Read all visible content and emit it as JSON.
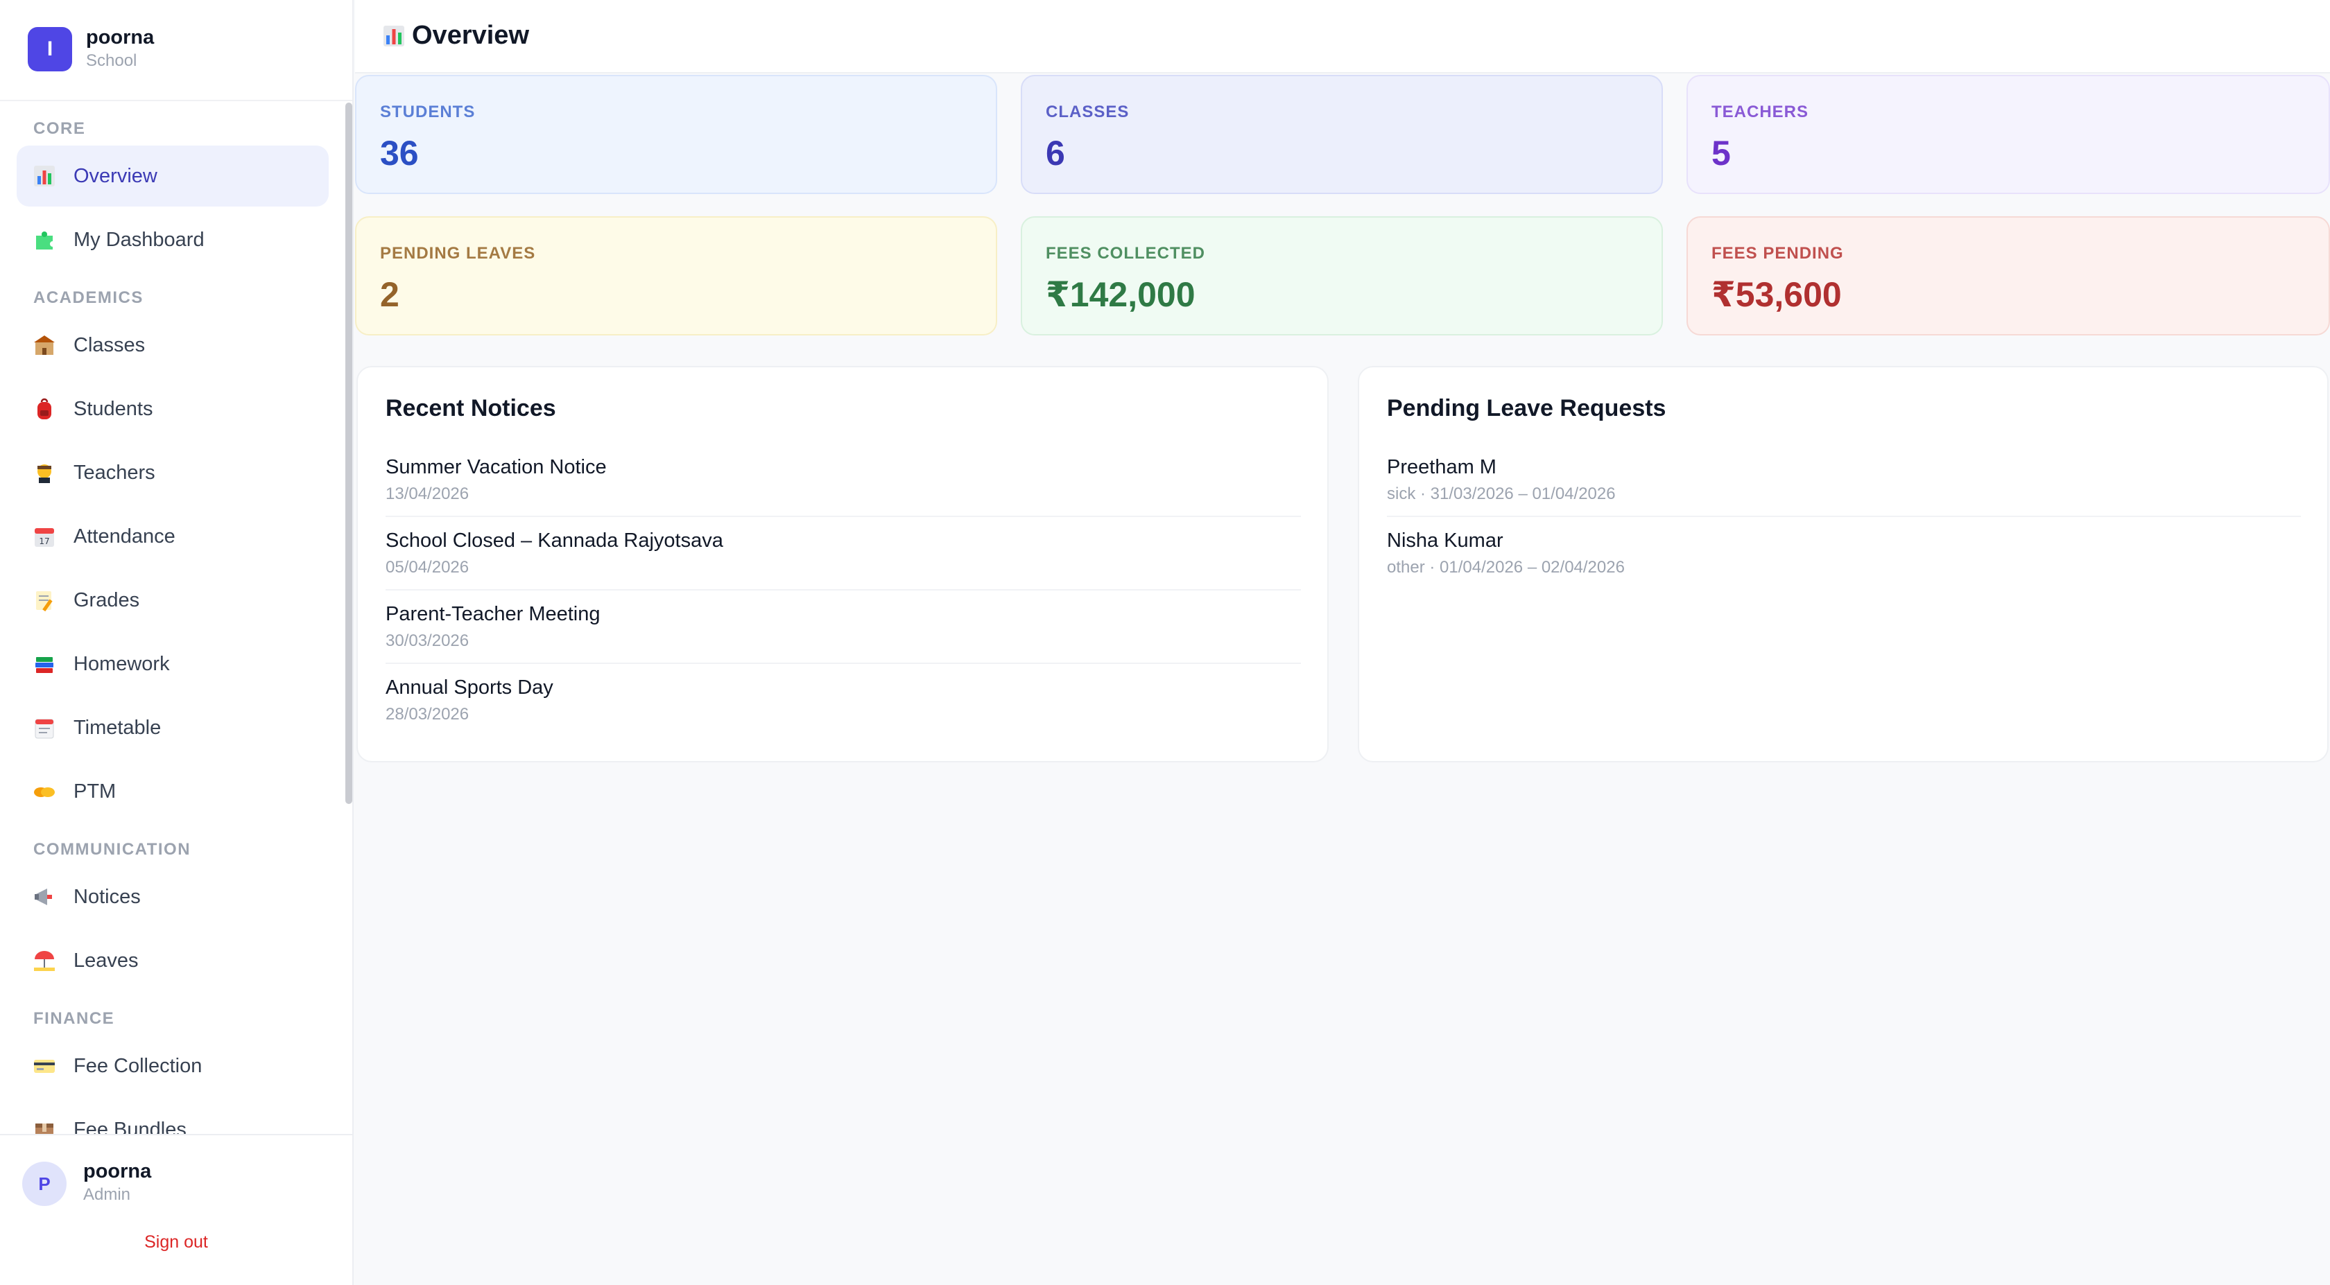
{
  "brand": {
    "initial": "I",
    "name": "poorna",
    "subtitle": "School"
  },
  "sidebar": {
    "sections": [
      {
        "label": "CORE"
      },
      {
        "label": "ACADEMICS"
      },
      {
        "label": "COMMUNICATION"
      },
      {
        "label": "FINANCE"
      }
    ],
    "items": [
      {
        "label": "Overview",
        "icon": "bar-chart-icon",
        "active": true
      },
      {
        "label": "My Dashboard",
        "icon": "puzzle-icon"
      },
      {
        "label": "Classes",
        "icon": "school-building-icon"
      },
      {
        "label": "Students",
        "icon": "backpack-icon"
      },
      {
        "label": "Teachers",
        "icon": "teacher-icon"
      },
      {
        "label": "Attendance",
        "icon": "calendar-icon"
      },
      {
        "label": "Grades",
        "icon": "memo-icon"
      },
      {
        "label": "Homework",
        "icon": "books-icon"
      },
      {
        "label": "Timetable",
        "icon": "tear-off-calendar-icon"
      },
      {
        "label": "PTM",
        "icon": "handshake-icon"
      },
      {
        "label": "Notices",
        "icon": "megaphone-icon"
      },
      {
        "label": "Leaves",
        "icon": "beach-umbrella-icon"
      },
      {
        "label": "Fee Collection",
        "icon": "credit-card-icon"
      },
      {
        "label": "Fee Bundles",
        "icon": "package-icon"
      }
    ]
  },
  "user": {
    "initial": "P",
    "name": "poorna",
    "role": "Admin",
    "signout_label": "Sign out"
  },
  "header": {
    "title": "Overview",
    "title_icon": "bar-chart-icon"
  },
  "stats": [
    {
      "label": "STUDENTS",
      "value": "36"
    },
    {
      "label": "CLASSES",
      "value": "6"
    },
    {
      "label": "TEACHERS",
      "value": "5"
    },
    {
      "label": "PENDING LEAVES",
      "value": "2"
    },
    {
      "label": "FEES COLLECTED",
      "value": "₹142,000"
    },
    {
      "label": "FEES PENDING",
      "value": "₹53,600"
    }
  ],
  "notices": {
    "title": "Recent Notices",
    "items": [
      {
        "title": "Summer Vacation Notice",
        "date": "13/04/2026"
      },
      {
        "title": "School Closed – Kannada Rajyotsava",
        "date": "05/04/2026"
      },
      {
        "title": "Parent-Teacher Meeting",
        "date": "30/03/2026"
      },
      {
        "title": "Annual Sports Day",
        "date": "28/03/2026"
      }
    ]
  },
  "leaves": {
    "title": "Pending Leave Requests",
    "items": [
      {
        "name": "Preetham M",
        "detail": "sick · 31/03/2026 – 01/04/2026"
      },
      {
        "name": "Nisha Kumar",
        "detail": "other · 01/04/2026 – 02/04/2026"
      }
    ]
  },
  "colors": {
    "accent": "#4f46e5",
    "students_bg": "#eef4fe",
    "students_fg": "#2b4fc4",
    "classes_bg": "#eceffc",
    "classes_fg": "#3b38b3",
    "teachers_bg": "#f5f3fe",
    "teachers_fg": "#6d32c9",
    "leaves_bg": "#fefbe8",
    "leaves_fg": "#94632a",
    "collected_bg": "#f0fbf3",
    "collected_fg": "#2f7a45",
    "pending_bg": "#fdf1ef",
    "pending_fg": "#b03030",
    "signout": "#dc2626"
  }
}
